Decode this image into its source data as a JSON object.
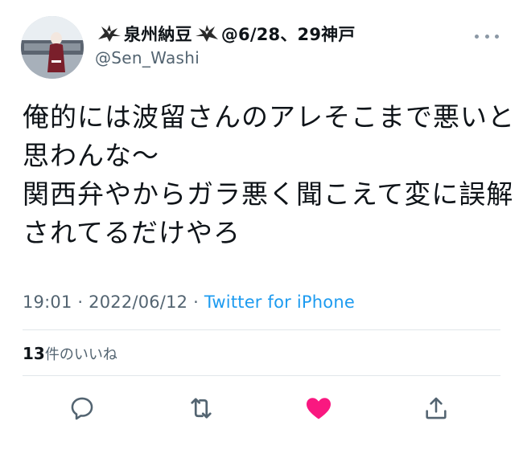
{
  "user": {
    "display_name": "泉州納豆",
    "name_suffix": "@6/28、29神戸",
    "handle": "@Sen_Washi",
    "avatar_icon": "profile-photo",
    "name_icon": "eagle-icon"
  },
  "tweet": {
    "lines": [
      "俺的には波留さんのアレそこまで悪いと",
      "思わんな〜",
      "関西弁やからガラ悪く聞こえて変に誤解",
      "されてるだけやろ"
    ]
  },
  "meta": {
    "time": "19:01",
    "separator1": " · ",
    "date": "2022/06/12",
    "separator2": " · ",
    "source": "Twitter for iPhone"
  },
  "likes": {
    "count": "13",
    "label": "件のいいね"
  },
  "actions": {
    "reply_icon": "reply-icon",
    "retweet_icon": "retweet-icon",
    "like_icon": "heart-icon",
    "share_icon": "share-icon"
  },
  "colors": {
    "text": "#0f1419",
    "secondary": "#536471",
    "link": "#1d9bf0",
    "like_active": "#f91880",
    "icon": "#536471"
  }
}
